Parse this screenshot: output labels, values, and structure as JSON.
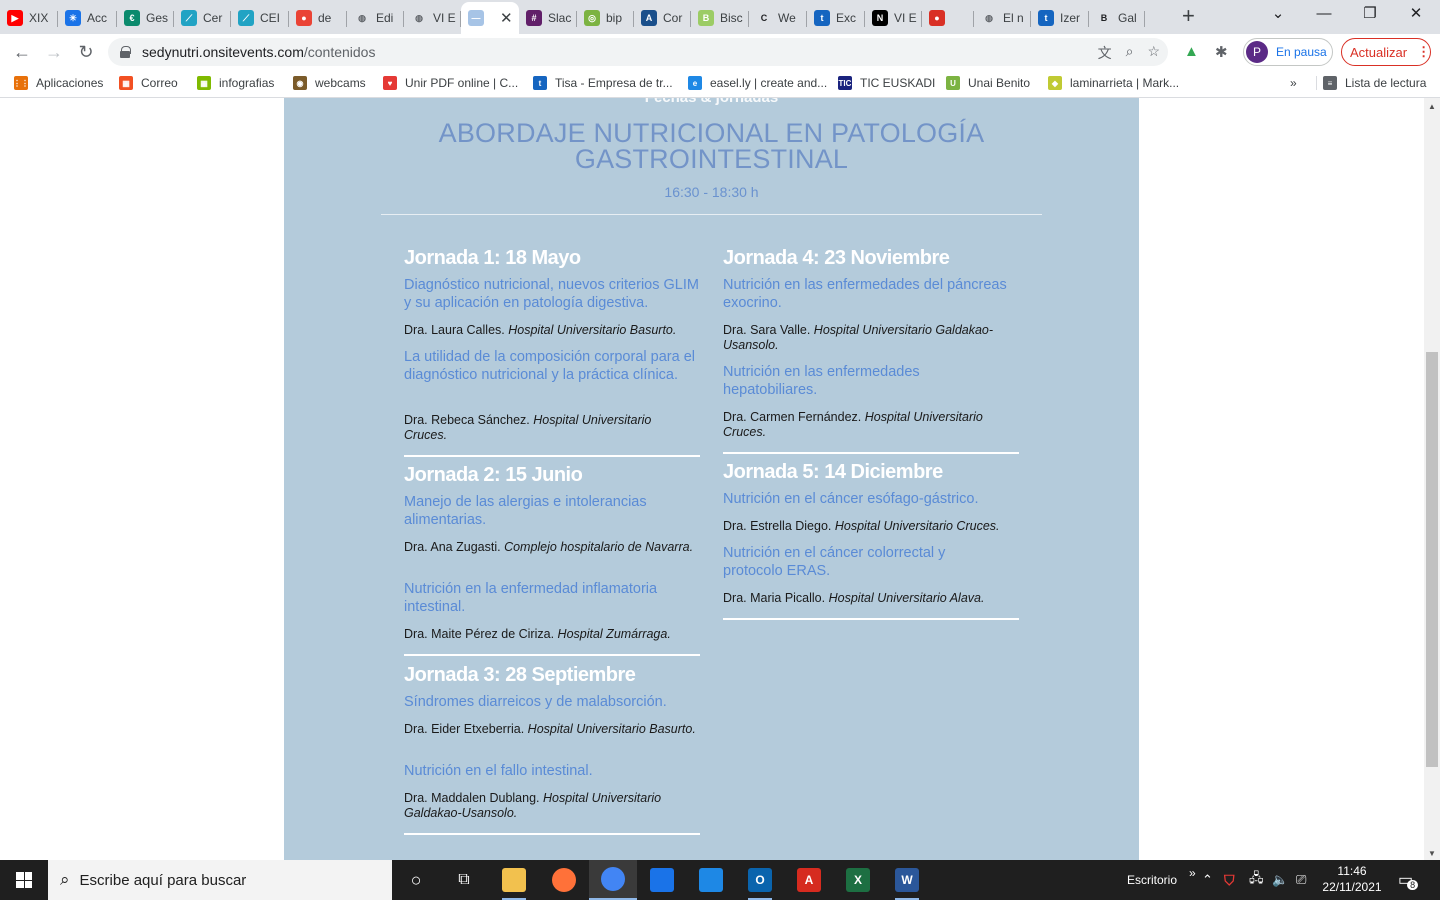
{
  "browser": {
    "tabs": [
      {
        "label": "XIX",
        "icon": "youtube-icon",
        "color": "#ff0000"
      },
      {
        "label": "Acc",
        "icon": "asterisk-icon",
        "color": "#1a73e8"
      },
      {
        "label": "Ges",
        "icon": "euskalit-icon",
        "color": "#0b8a6d"
      },
      {
        "label": "Cer",
        "icon": "chart-icon",
        "color": "#21a3c4"
      },
      {
        "label": "CEI",
        "icon": "chart-icon",
        "color": "#21a3c4"
      },
      {
        "label": "de",
        "icon": "maps-pin-icon",
        "color": "#ea4335"
      },
      {
        "label": "Edi",
        "icon": "globe-icon",
        "color": "#5f6368"
      },
      {
        "label": "VI E",
        "icon": "globe-icon",
        "color": "#5f6368"
      },
      {
        "label": "",
        "icon": "onsite-icon",
        "color": "#a7c4e6",
        "active": true
      },
      {
        "label": "Slac",
        "icon": "slack-icon",
        "color": "#611f69"
      },
      {
        "label": "bip",
        "icon": "bip-icon",
        "color": "#7cb342"
      },
      {
        "label": "Cor",
        "icon": "aedv-icon",
        "color": "#1a4f8b"
      },
      {
        "label": "Bisc",
        "icon": "bisc-icon",
        "color": "#9ccc65"
      },
      {
        "label": "We",
        "icon": "refresh-icon",
        "color": "#202124"
      },
      {
        "label": "Exc",
        "icon": "tisa-icon",
        "color": "#1565c0"
      },
      {
        "label": "VI E",
        "icon": "notion-icon",
        "color": "#000000"
      },
      {
        "label": "",
        "icon": "record-icon",
        "color": "#d93025"
      },
      {
        "label": "El n",
        "icon": "globe-icon",
        "color": "#5f6368"
      },
      {
        "label": "Izer",
        "icon": "tisa-icon",
        "color": "#1565c0"
      },
      {
        "label": "Gal",
        "icon": "b-icon",
        "color": "#202124"
      }
    ],
    "url_host": "sedynutri.onsitevents.com",
    "url_path": "/contenidos",
    "profile_initial": "P",
    "profile_label": "En pausa",
    "update_label": "Actualizar",
    "bookmarks": [
      {
        "label": "Aplicaciones",
        "icon": "apps-grid-icon",
        "color": "#e8710a"
      },
      {
        "label": "Correo",
        "icon": "office-icon",
        "color": "#f25022"
      },
      {
        "label": "infografias",
        "icon": "office-icon",
        "color": "#7fba00"
      },
      {
        "label": "webcams",
        "icon": "webcams-icon",
        "color": "#7b5b2a"
      },
      {
        "label": "Unir PDF online | C...",
        "icon": "heart-icon",
        "color": "#e53935"
      },
      {
        "label": "Tisa - Empresa de tr...",
        "icon": "tisa-icon",
        "color": "#1565c0"
      },
      {
        "label": "easel.ly | create and...",
        "icon": "easelly-icon",
        "color": "#1e88e5"
      },
      {
        "label": "TIC EUSKADI",
        "icon": "tic-icon",
        "color": "#1a237e"
      },
      {
        "label": "Unai Benito",
        "icon": "u-icon",
        "color": "#7cb342"
      },
      {
        "label": "laminarrieta | Mark...",
        "icon": "laminarrieta-icon",
        "color": "#c0ca33"
      }
    ],
    "bookmarks_more": "»",
    "reading_list": "Lista de lectura"
  },
  "page": {
    "cut_label": "Fechas & jornadas",
    "title_line1": "ABORDAJE NUTRICIONAL EN PATOLOGÍA",
    "title_line2": "GASTROINTESTINAL",
    "time": "16:30 - 18:30 h",
    "jornadas": [
      {
        "title": "Jornada 1: 18 Mayo",
        "topics": [
          {
            "topic": "Diagnóstico nutricional, nuevos criterios GLIM y su aplicación en patología digestiva.",
            "speaker": "Dra. Laura Calles.",
            "hospital": "Hospital Universitario Basurto."
          },
          {
            "topic": "La utilidad de la composición corporal para el diagnóstico nutricional y la práctica clínica.",
            "speaker": "Dra. Rebeca Sánchez.",
            "hospital": "Hospital Universitario Cruces."
          }
        ]
      },
      {
        "title": "Jornada 2: 15 Junio",
        "topics": [
          {
            "topic": "Manejo de las alergias e intolerancias alimentarias.",
            "speaker": "Dra. Ana Zugasti.",
            "hospital": "Complejo hospitalario de Navarra."
          },
          {
            "topic": "Nutrición en la enfermedad inflamatoria intestinal.",
            "speaker": "Dra. Maite Pérez de Ciriza.",
            "hospital": "Hospital Zumárraga."
          }
        ]
      },
      {
        "title": "Jornada 3: 28 Septiembre",
        "topics": [
          {
            "topic": "Síndromes diarreicos y de malabsorción.",
            "speaker": "Dra. Eider Etxeberria.",
            "hospital": "Hospital Universitario Basurto."
          },
          {
            "topic": "Nutrición en el fallo intestinal.",
            "speaker": "Dra. Maddalen Dublang.",
            "hospital": "Hospital Universitario Galdakao-Usansolo."
          }
        ]
      },
      {
        "title": "Jornada 4: 23 Noviembre",
        "topics": [
          {
            "topic": "Nutrición en las enfermedades del páncreas exocrino.",
            "speaker": "Dra. Sara Valle.",
            "hospital": "Hospital Universitario Galdakao-Usansolo."
          },
          {
            "topic": "Nutrición en las enfermedades hepatobiliares.",
            "speaker": "Dra. Carmen Fernández.",
            "hospital": "Hospital Universitario Cruces."
          }
        ]
      },
      {
        "title": "Jornada 5: 14 Diciembre",
        "topics": [
          {
            "topic": "Nutrición en el cáncer esófago-gástrico.",
            "speaker": "Dra. Estrella Diego.",
            "hospital": "Hospital Universitario Cruces."
          },
          {
            "topic": "Nutrición en el cáncer colorrectal y protocolo ERAS.",
            "speaker": "Dra. Maria Picallo.",
            "hospital": "Hospital Universitario Alava."
          }
        ]
      }
    ]
  },
  "taskbar": {
    "search_placeholder": "Escribe aquí para buscar",
    "desktop_label": "Escritorio",
    "desktop_more": "»",
    "time": "11:46",
    "date": "22/11/2021",
    "notifications": "8",
    "apps": [
      {
        "name": "file-explorer",
        "glyph": "",
        "color": "#f2c14e"
      },
      {
        "name": "firefox",
        "glyph": "",
        "color": "#ff7139"
      },
      {
        "name": "chrome",
        "glyph": "",
        "color": "#4285f4"
      },
      {
        "name": "thunderbird",
        "glyph": "",
        "color": "#1a73e8"
      },
      {
        "name": "calendar",
        "glyph": "",
        "color": "#1e88e5"
      },
      {
        "name": "outlook",
        "glyph": "O",
        "color": "#0a64ad"
      },
      {
        "name": "acrobat",
        "glyph": "A",
        "color": "#d62b1f"
      },
      {
        "name": "excel",
        "glyph": "X",
        "color": "#1d6f42"
      },
      {
        "name": "word",
        "glyph": "W",
        "color": "#2b579a"
      }
    ]
  }
}
